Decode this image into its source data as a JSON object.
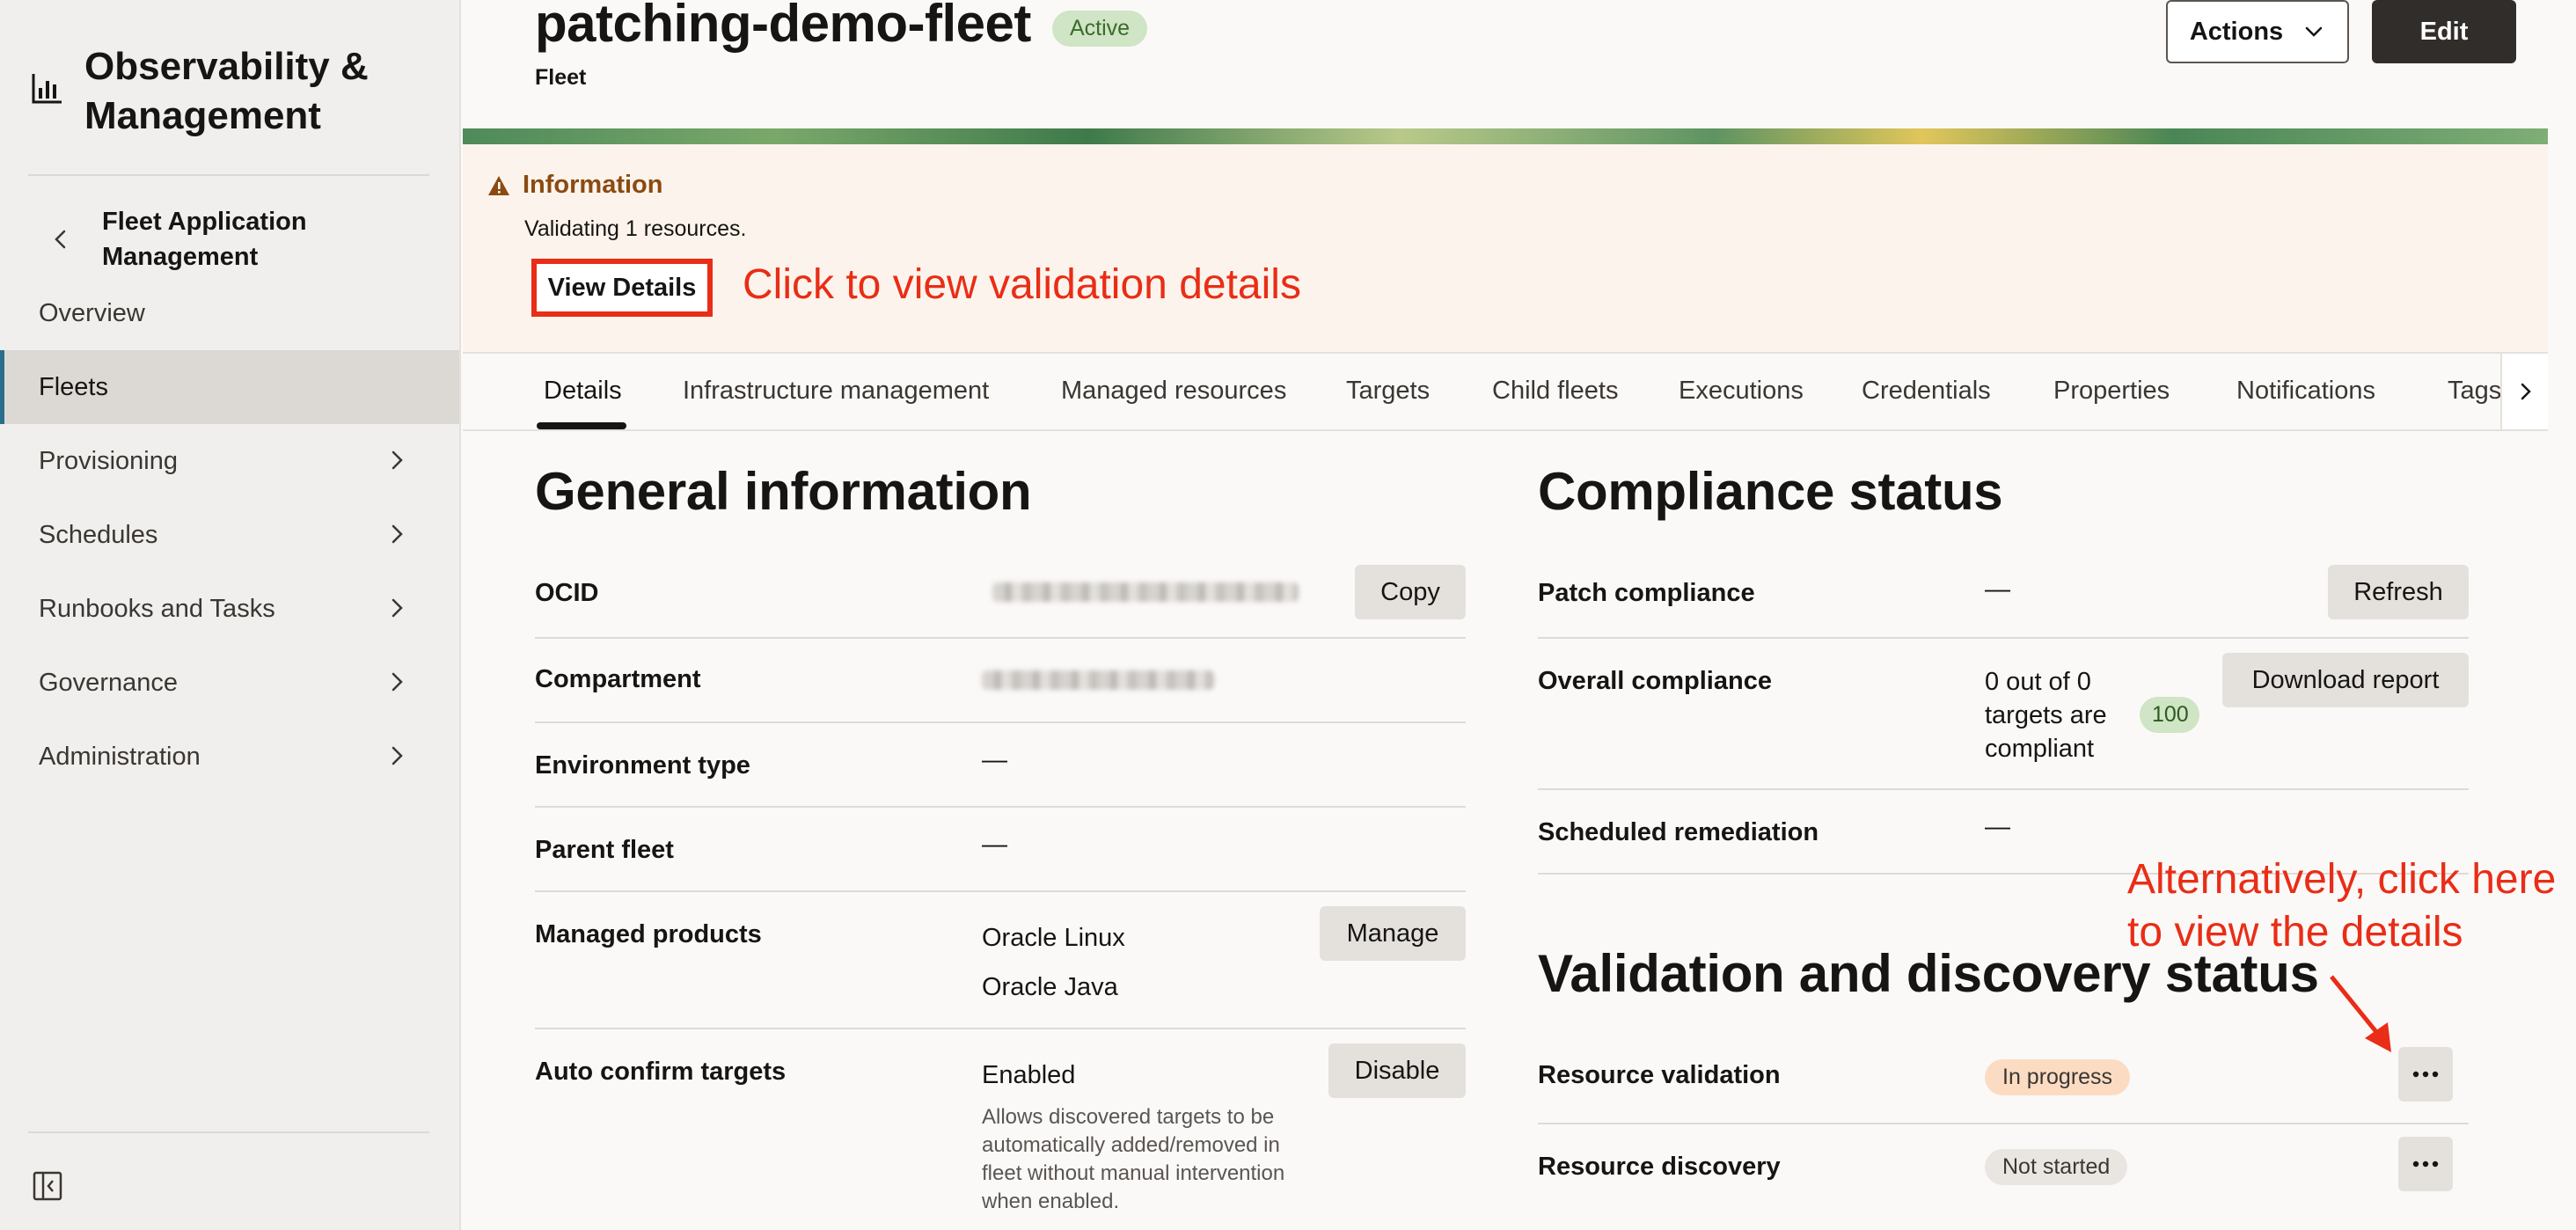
{
  "sidebar": {
    "brand": "Observability & Management",
    "back_label": "Fleet Application Management",
    "items": [
      {
        "label": "Overview"
      },
      {
        "label": "Fleets"
      },
      {
        "label": "Provisioning"
      },
      {
        "label": "Schedules"
      },
      {
        "label": "Runbooks and Tasks"
      },
      {
        "label": "Governance"
      },
      {
        "label": "Administration"
      }
    ]
  },
  "header": {
    "title": "patching-demo-fleet",
    "status": "Active",
    "subtitle": "Fleet",
    "actions_label": "Actions",
    "edit_label": "Edit"
  },
  "info": {
    "title": "Information",
    "message": "Validating 1 resources.",
    "view_details_label": "View Details"
  },
  "annotations": {
    "top": "Click to view validation details",
    "side_line1": "Alternatively, click here",
    "side_line2": "to view the details"
  },
  "tabs": [
    "Details",
    "Infrastructure management",
    "Managed resources",
    "Targets",
    "Child fleets",
    "Executions",
    "Credentials",
    "Properties",
    "Notifications",
    "Tags"
  ],
  "general": {
    "heading": "General information",
    "ocid_label": "OCID",
    "copy_label": "Copy",
    "compartment_label": "Compartment",
    "env_label": "Environment type",
    "env_value": "—",
    "parent_label": "Parent fleet",
    "parent_value": "—",
    "products_label": "Managed products",
    "products": [
      "Oracle Linux",
      "Oracle Java"
    ],
    "manage_label": "Manage",
    "auto_label": "Auto confirm targets",
    "auto_value": "Enabled",
    "disable_label": "Disable",
    "auto_help": "Allows discovered targets to be automatically added/removed in fleet without manual intervention when enabled."
  },
  "compliance": {
    "heading": "Compliance status",
    "patch_label": "Patch compliance",
    "patch_value": "—",
    "refresh_label": "Refresh",
    "overall_label": "Overall compliance",
    "overall_value": "0 out of 0 targets are compliant",
    "overall_pct": "100",
    "download_label": "Download report",
    "sched_label": "Scheduled remediation",
    "sched_value": "—"
  },
  "validation": {
    "heading": "Validation and discovery status",
    "resource_validation_label": "Resource validation",
    "resource_validation_status": "In progress",
    "resource_discovery_label": "Resource discovery",
    "resource_discovery_status": "Not started"
  },
  "colors": {
    "accent_red": "#e92d16",
    "active_green": "#cfe5c5",
    "progress_orange": "#fbdcc2",
    "dark_button": "#312d2a"
  }
}
